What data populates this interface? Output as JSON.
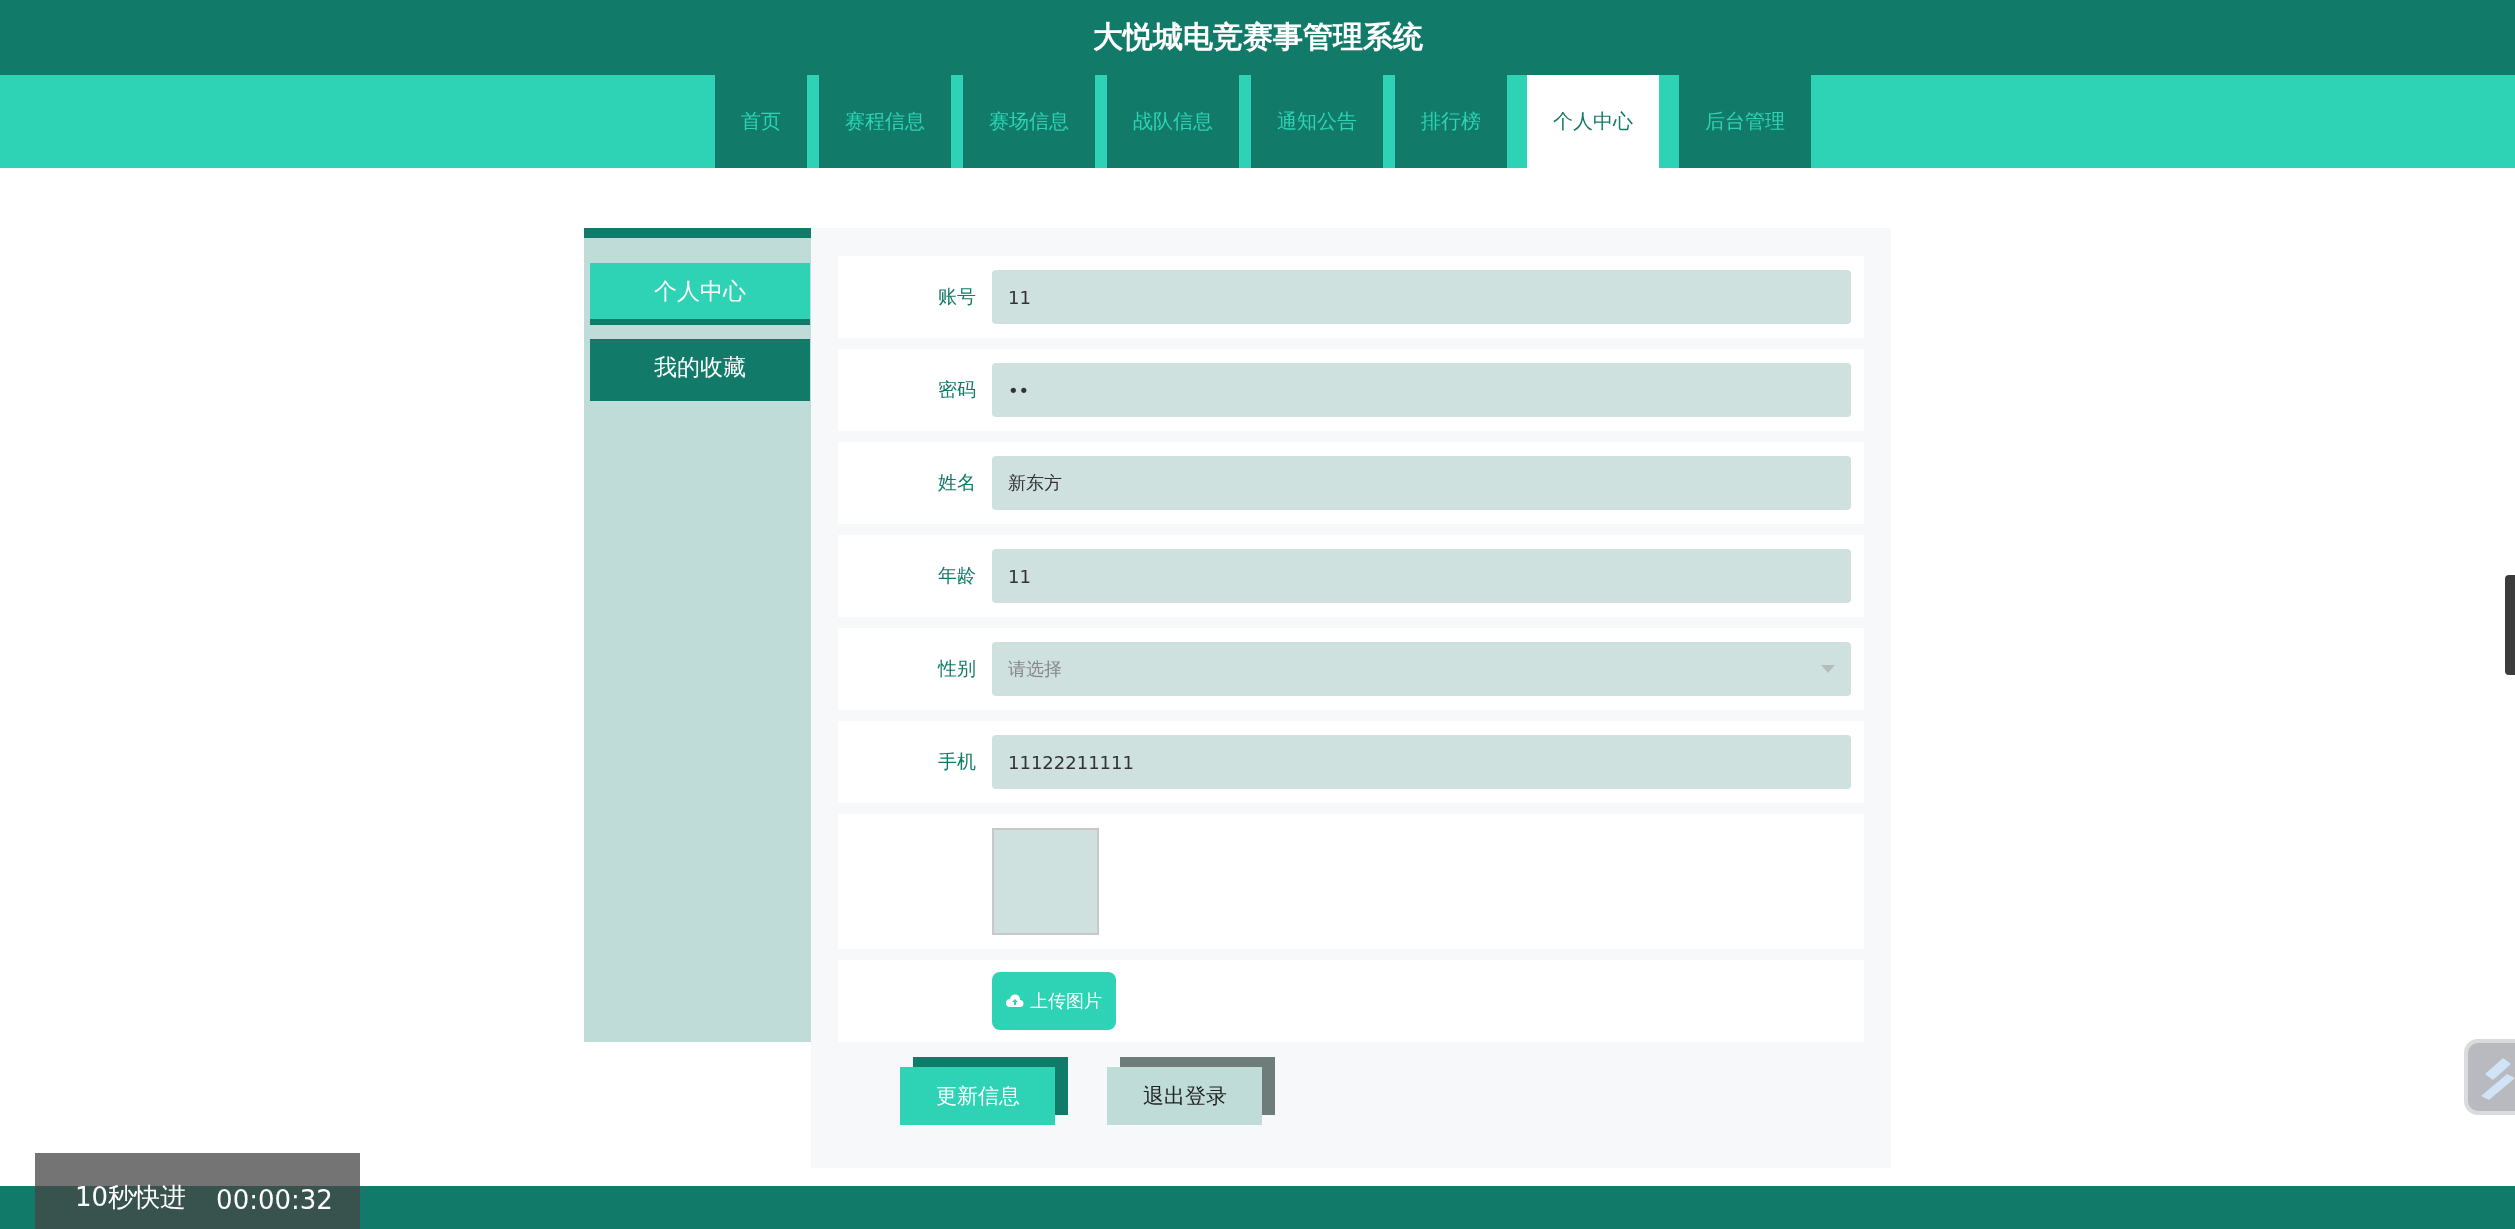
{
  "header": {
    "title": "大悦城电竞赛事管理系统"
  },
  "nav": [
    {
      "label": "首页",
      "selected": false
    },
    {
      "label": "赛程信息",
      "selected": false
    },
    {
      "label": "赛场信息",
      "selected": false
    },
    {
      "label": "战队信息",
      "selected": false
    },
    {
      "label": "通知公告",
      "selected": false
    },
    {
      "label": "排行榜",
      "selected": false
    },
    {
      "label": "个人中心",
      "selected": true
    },
    {
      "label": "后台管理",
      "selected": false
    }
  ],
  "sidebar": {
    "items": [
      {
        "label": "个人中心",
        "selected": true
      },
      {
        "label": "我的收藏",
        "selected": false
      }
    ]
  },
  "form": {
    "fields": [
      {
        "kind": "text",
        "label": "账号",
        "value": "11"
      },
      {
        "kind": "text",
        "label": "密码",
        "value": "••"
      },
      {
        "kind": "text",
        "label": "姓名",
        "value": "新东方"
      },
      {
        "kind": "text",
        "label": "年龄",
        "value": "11"
      },
      {
        "kind": "select",
        "label": "性别",
        "placeholder": "请选择"
      },
      {
        "kind": "text",
        "label": "手机",
        "value": "11122211111"
      },
      {
        "kind": "image"
      },
      {
        "kind": "upload",
        "button": "上传图片"
      }
    ],
    "buttons": [
      {
        "kind": "primary",
        "label": "更新信息"
      },
      {
        "kind": "secondary",
        "label": "退出登录"
      }
    ]
  },
  "player_overlay": {
    "label": "10秒快进",
    "time": "00:00:32"
  }
}
